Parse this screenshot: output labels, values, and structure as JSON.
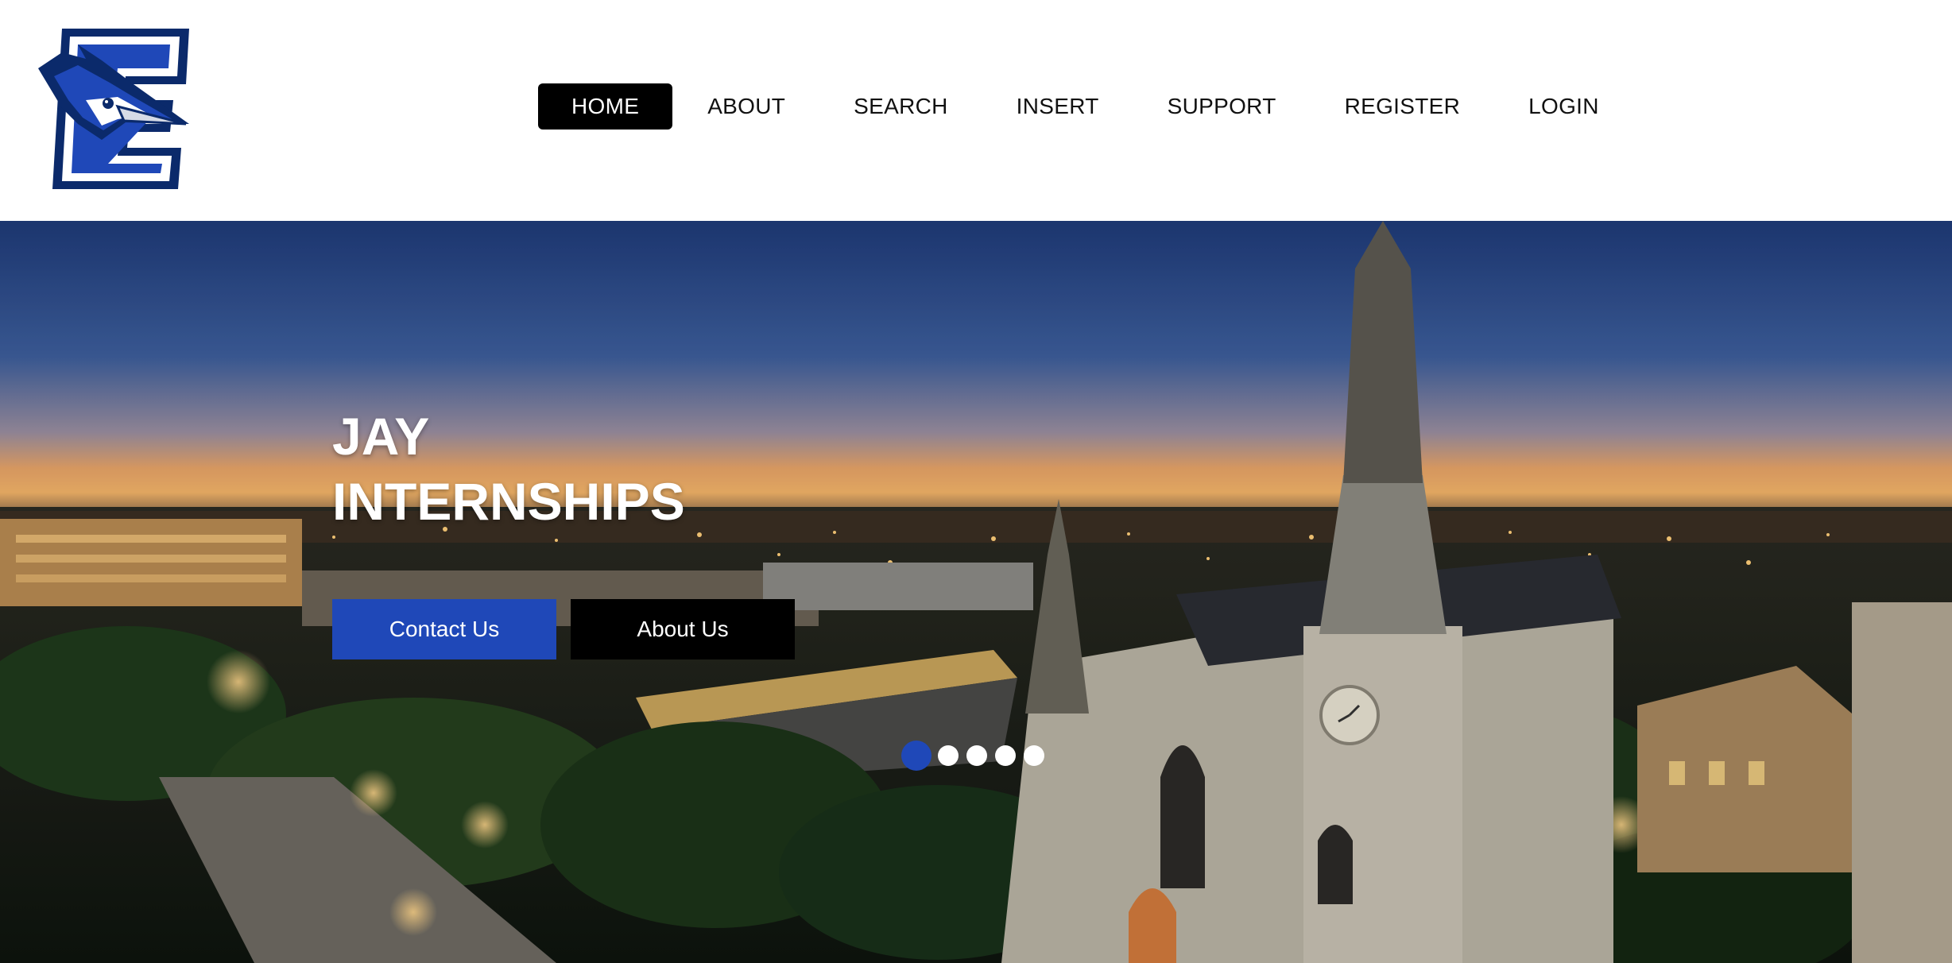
{
  "brand": {
    "logo_icon": "bluejay-c-logo-icon",
    "colors": {
      "primary_blue": "#1f48b8",
      "navy": "#0b2a6b",
      "black": "#000000",
      "white": "#ffffff"
    }
  },
  "nav": {
    "items": [
      {
        "label": "HOME",
        "active": true
      },
      {
        "label": "ABOUT",
        "active": false
      },
      {
        "label": "SEARCH",
        "active": false
      },
      {
        "label": "INSERT",
        "active": false
      },
      {
        "label": "SUPPORT",
        "active": false
      },
      {
        "label": "REGISTER",
        "active": false
      },
      {
        "label": "LOGIN",
        "active": false
      }
    ]
  },
  "hero": {
    "title_line1": "JAY",
    "title_line2": "INTERNSHIPS",
    "contact_button": "Contact Us",
    "about_button": "About Us",
    "slides_total": 5,
    "active_slide": 1
  }
}
